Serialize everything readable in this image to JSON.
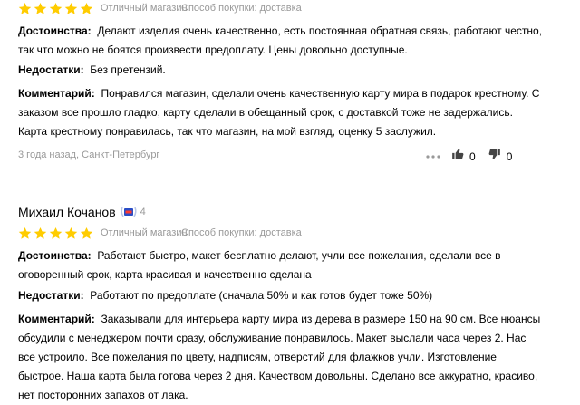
{
  "review1": {
    "rating": 5,
    "rating_label": "Отличный магазин",
    "purchase_method": "Способ покупки: доставка",
    "pros_label": "Достоинства:",
    "pros_text": "Делают изделия очень качественно, есть постоянная обратная связь, работают честно, так что можно не боятся произвести предоплату. Цены довольно доступные.",
    "cons_label": "Недостатки:",
    "cons_text": "Без претензий.",
    "comment_label": "Комментарий:",
    "comment_text": "Понравился магазин, сделали очень качественную карту мира в подарок крестному. С заказом все прошло гладко, карту сделали в обещанный срок, с доставкой тоже не задержались. Карта крестному понравилась, так что магазин, на мой взгляд, оценку 5 заслужил.",
    "date_location": "3 года назад, Санкт-Петербург",
    "likes": "0",
    "dislikes": "0"
  },
  "review2": {
    "author": "Михаил Кочанов",
    "badge_count": "4",
    "rating": 5,
    "rating_label": "Отличный магазин",
    "purchase_method": "Способ покупки: доставка",
    "pros_label": "Достоинства:",
    "pros_text": "Работают быстро, макет бесплатно делают, учли все пожелания, сделали все в оговоренный срок, карта красивая и качественно сделана",
    "cons_label": "Недостатки:",
    "cons_text": "Работают по предоплате (сначала 50% и как готов будет тоже 50%)",
    "comment_label": "Комментарий:",
    "comment_text": "Заказывали для интерьера карту мира из дерева в размере 150 на 90 см. Все нюансы обсудили с менеджером почти сразу, обслуживание понравилось. Макет выслали часа через 2. Нас все устроило. Все пожелания по цвету, надписям, отверстий для флажков учли. Изготовление быстрое. Наша карта была готова через 2 дня. Качеством довольны. Сделано все аккуратно, красиво, нет посторонних запахов от лака."
  },
  "colors": {
    "star": "#ffcc00",
    "muted": "#999999",
    "text": "#000000"
  },
  "icons": {
    "like": "thumbs-up-icon",
    "dislike": "thumbs-down-icon",
    "more": "more-dots-icon",
    "badge": "reviewer-badge-icon"
  }
}
